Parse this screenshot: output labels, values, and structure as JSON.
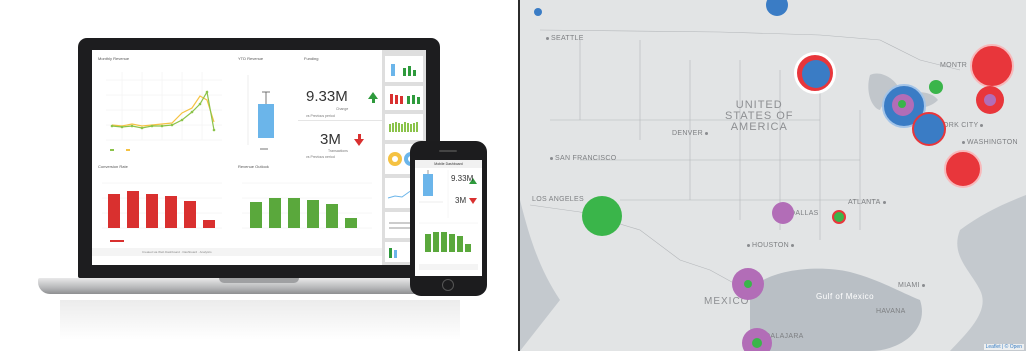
{
  "dashboard": {
    "panel_titles": {
      "monthly_revenue": "Monthly Revenue",
      "ytd_revenue": "YTD Revenue",
      "funding": "Funding",
      "conversion": "Conversion Rate",
      "revenue_outlook": "Revenue Outlook"
    },
    "kpi_top": {
      "value": "9.33M",
      "label": "Change",
      "note": "vs Previous period"
    },
    "kpi_bottom": {
      "value": "3M",
      "label": "Transactions",
      "note": "vs Previous period"
    },
    "footer": "Created via Web Dashboard · Dashboard · Analytics",
    "colors": {
      "green": "#2e9a3c",
      "red": "#d9302f",
      "blue": "#4a90d9",
      "line": "#8bc34a"
    }
  },
  "phone": {
    "title": "Mobile Dashboard",
    "kpi_top": "9.33M",
    "kpi_bottom": "3M"
  },
  "map": {
    "country_label": "UNITED\nSTATES OF\nAMERICA",
    "cities": {
      "seattle": "SEATTLE",
      "san_francisco": "SAN FRANCISCO",
      "los_angeles": "LOS ANGELES",
      "denver": "DENVER",
      "dallas": "DALLAS",
      "houston": "HOUSTON",
      "atlanta": "ATLANTA",
      "washington": "WASHINGTON",
      "new_york": "YORK CITY",
      "montreal": "MONTR",
      "miami": "MIAMI",
      "havana": "HAVANA",
      "guadalajara": "GUADALAJARA",
      "mexico": "MEXICO"
    },
    "gulf_label": "Gulf of Mexico",
    "attribution": "Leaflet | © Open",
    "colors": {
      "red": "#e8363b",
      "blue": "#3a7cc5",
      "green": "#3ab54a",
      "purple": "#b26db7",
      "land": "#e2e4e5",
      "water": "#b8bec4"
    }
  }
}
